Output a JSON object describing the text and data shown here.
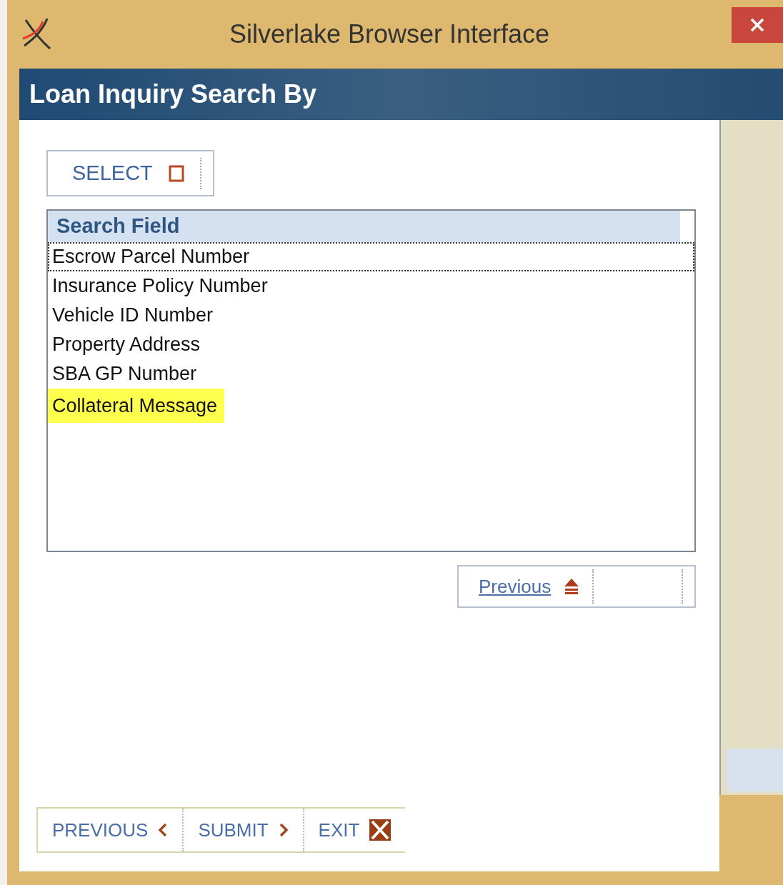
{
  "window": {
    "title": "Silverlake Browser Interface"
  },
  "header": {
    "title": "Loan Inquiry Search By"
  },
  "select_button": {
    "label": "SELECT"
  },
  "list": {
    "column": "Search Field",
    "items": [
      {
        "label": "Escrow Parcel Number",
        "focused": true,
        "highlighted": false
      },
      {
        "label": "Insurance Policy Number",
        "focused": false,
        "highlighted": false
      },
      {
        "label": "Vehicle ID Number",
        "focused": false,
        "highlighted": false
      },
      {
        "label": "Property Address",
        "focused": false,
        "highlighted": false
      },
      {
        "label": "SBA GP Number",
        "focused": false,
        "highlighted": false
      },
      {
        "label": "Collateral Message",
        "focused": false,
        "highlighted": true
      }
    ]
  },
  "previous_link": {
    "label": "Previous"
  },
  "footer_buttons": [
    {
      "label": "PREVIOUS",
      "kind": "back"
    },
    {
      "label": "SUBMIT",
      "kind": "forward"
    },
    {
      "label": "EXIT",
      "kind": "exit"
    }
  ]
}
